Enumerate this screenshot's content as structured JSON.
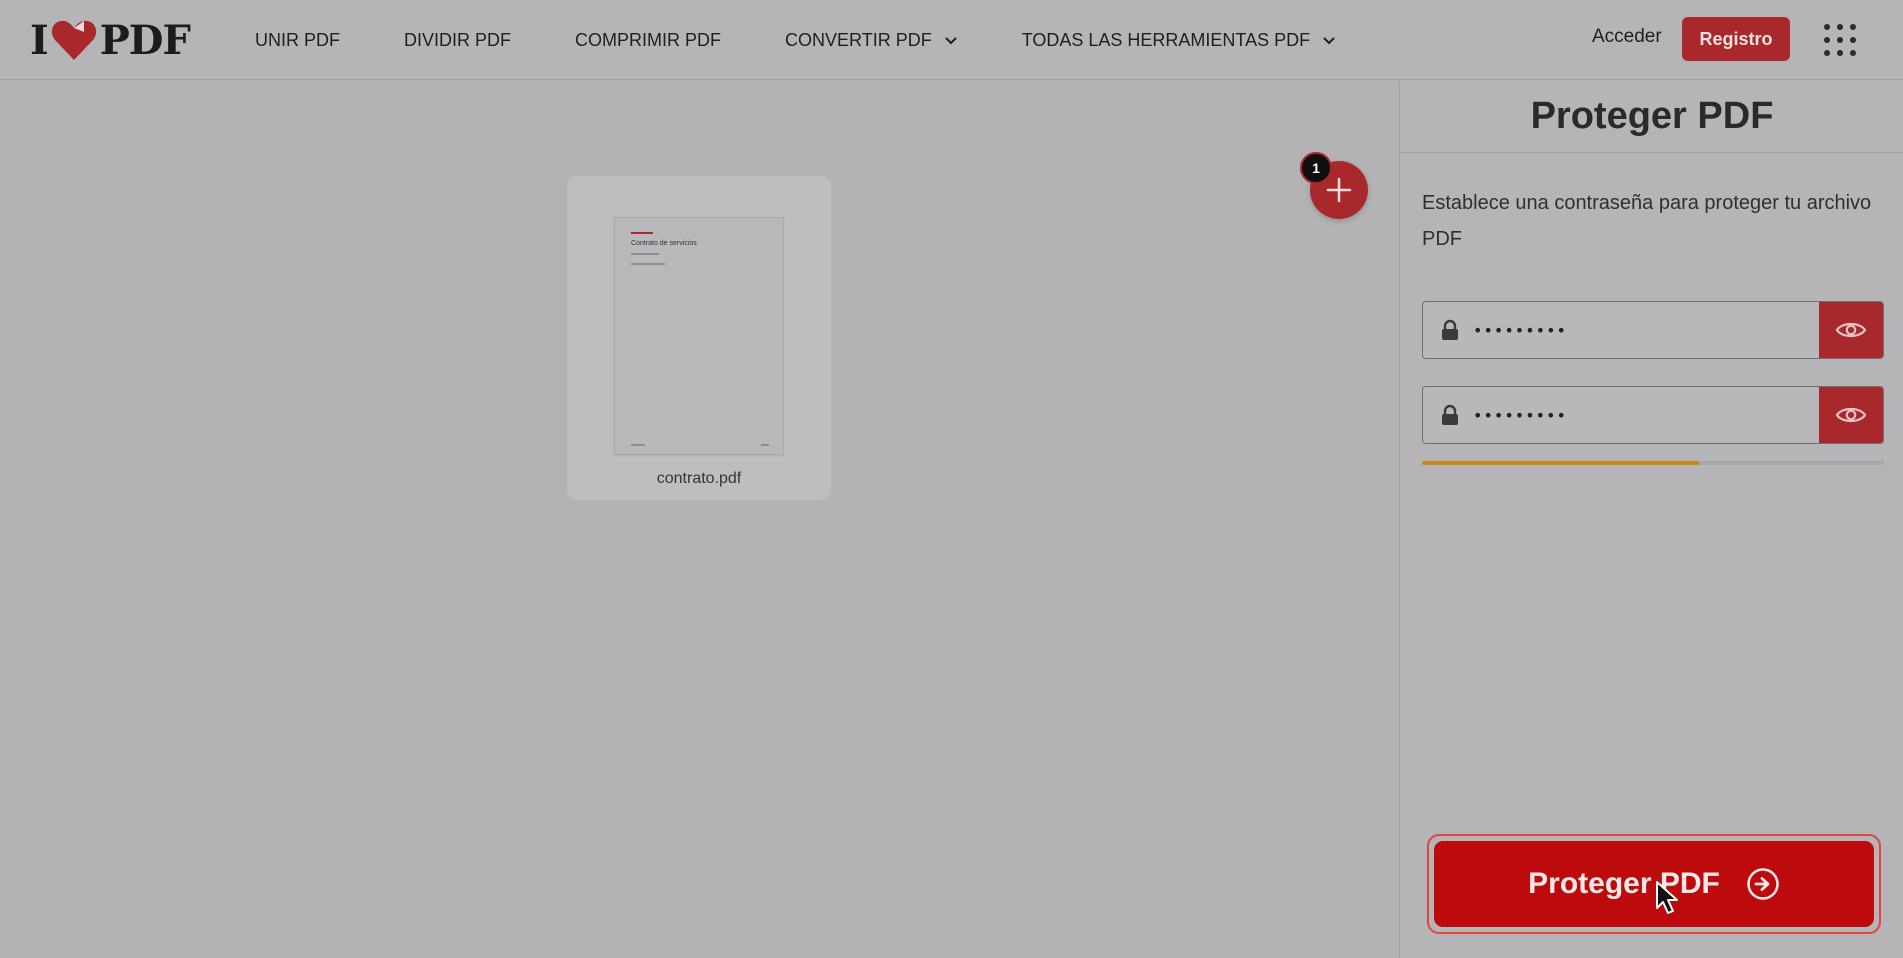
{
  "header": {
    "logo_left": "I",
    "logo_right": "PDF",
    "nav": [
      {
        "label": "UNIR PDF",
        "dropdown": false
      },
      {
        "label": "DIVIDIR PDF",
        "dropdown": false
      },
      {
        "label": "COMPRIMIR PDF",
        "dropdown": false
      },
      {
        "label": "CONVERTIR PDF",
        "dropdown": true
      },
      {
        "label": "TODAS LAS HERRAMIENTAS PDF",
        "dropdown": true
      }
    ],
    "login_label": "Acceder",
    "register_label": "Registro",
    "apps_icon": "grid-icon"
  },
  "workspace": {
    "file": {
      "name": "contrato.pdf",
      "thumbnail_title": "Contrato de servicios"
    },
    "add_files_badge": "1",
    "add_icon": "plus-icon"
  },
  "sidebar": {
    "title": "Proteger PDF",
    "description": "Establece una contraseña para proteger tu archivo PDF",
    "password_value": "•••••••••",
    "confirm_value": "•••••••••",
    "strength_fraction": 0.6,
    "submit_label": "Proteger PDF"
  },
  "colors": {
    "brand_red": "#a8282c",
    "submit_red": "#bd0b0d",
    "strength": "#c9871a",
    "overlay_gray": "#b3b3b5"
  }
}
